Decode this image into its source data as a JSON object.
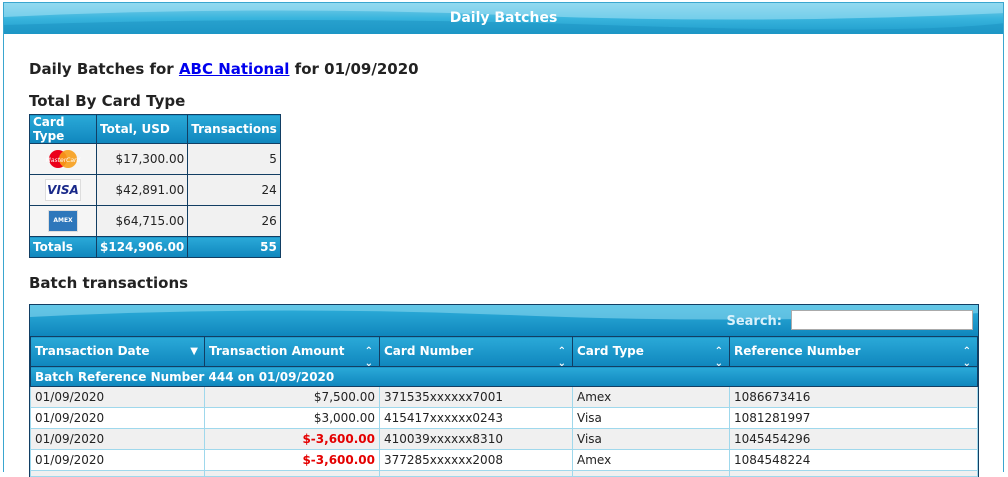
{
  "panel": {
    "title": "Daily Batches"
  },
  "heading": {
    "prefix": "Daily Batches for ",
    "merchant": "ABC National",
    "suffix": " for 01/09/2020"
  },
  "totals": {
    "title": "Total By Card Type",
    "columns": [
      "Card Type",
      "Total, USD",
      "Transactions"
    ],
    "rows": [
      {
        "card_icon": "mastercard-icon",
        "icon_text": "MasterCard",
        "total": "$17,300.00",
        "transactions": "5"
      },
      {
        "card_icon": "visa-icon",
        "icon_text": "VISA",
        "total": "$42,891.00",
        "transactions": "24"
      },
      {
        "card_icon": "amex-icon",
        "icon_text": "AMEX",
        "total": "$64,715.00",
        "transactions": "26"
      }
    ],
    "footer": {
      "label": "Totals",
      "total": "$124,906.00",
      "transactions": "55"
    }
  },
  "batch": {
    "title": "Batch transactions",
    "search": {
      "label": "Search:",
      "value": "",
      "placeholder": ""
    },
    "columns": [
      "Transaction Date",
      "Transaction Amount",
      "Card Number",
      "Card Type",
      "Reference Number"
    ],
    "group_label": "Batch Reference Number 444 on 01/09/2020",
    "rows": [
      {
        "date": "01/09/2020",
        "amount": "$7,500.00",
        "negative": false,
        "card_number": "371535xxxxxx7001",
        "card_type": "Amex",
        "reference": "1086673416"
      },
      {
        "date": "01/09/2020",
        "amount": "$3,000.00",
        "negative": false,
        "card_number": "415417xxxxxx0243",
        "card_type": "Visa",
        "reference": "1081281997"
      },
      {
        "date": "01/09/2020",
        "amount": "$-3,600.00",
        "negative": true,
        "card_number": "410039xxxxxx8310",
        "card_type": "Visa",
        "reference": "1045454296"
      },
      {
        "date": "01/09/2020",
        "amount": "$-3,600.00",
        "negative": true,
        "card_number": "377285xxxxxx2008",
        "card_type": "Amex",
        "reference": "1084548224"
      }
    ]
  },
  "colors": {
    "header_blue": "#1f9ccb",
    "negative_red": "#e40000",
    "link_blue": "#0000ee"
  }
}
